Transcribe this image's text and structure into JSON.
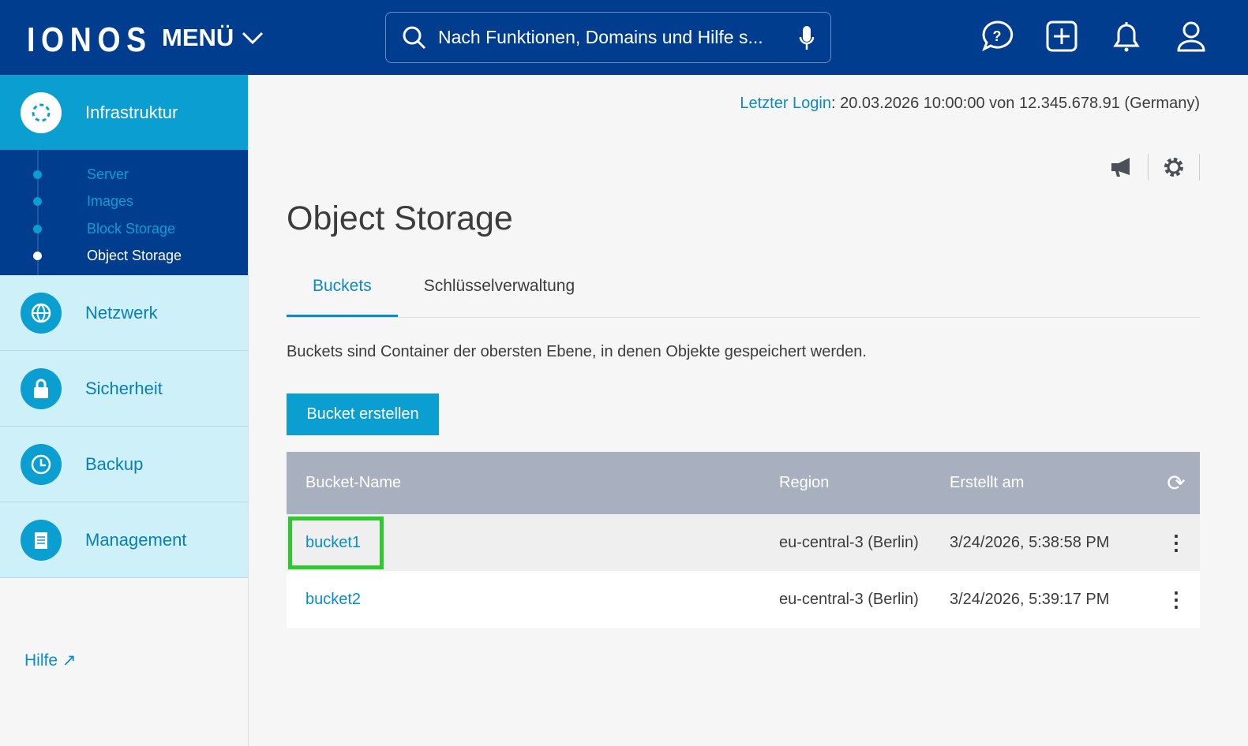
{
  "header": {
    "logo": "IONOS",
    "menu": "MENÜ",
    "search_placeholder": "Nach Funktionen, Domains und Hilfe s..."
  },
  "sidebar": {
    "sections": [
      {
        "label": "Infrastruktur",
        "children": [
          {
            "label": "Server"
          },
          {
            "label": "Images"
          },
          {
            "label": "Block Storage"
          },
          {
            "label": "Object Storage"
          }
        ]
      },
      {
        "label": "Netzwerk"
      },
      {
        "label": "Sicherheit"
      },
      {
        "label": "Backup"
      },
      {
        "label": "Management"
      }
    ],
    "help": "Hilfe"
  },
  "main": {
    "login_label": "Letzter Login",
    "login_text": ": 20.03.2026 10:00:00 von 12.345.678.91 (Germany)",
    "title": "Object Storage",
    "tabs": [
      {
        "label": "Buckets"
      },
      {
        "label": "Schlüsselverwaltung"
      }
    ],
    "description": "Buckets sind Container der obersten Ebene, in denen Objekte gespeichert werden.",
    "create_button": "Bucket erstellen",
    "table": {
      "headers": [
        "Bucket-Name",
        "Region",
        "Erstellt am"
      ],
      "rows": [
        [
          "bucket1",
          "eu-central-3 (Berlin)",
          "3/24/2026, 5:38:58 PM"
        ],
        [
          "bucket2",
          "eu-central-3 (Berlin)",
          "3/24/2026, 5:39:17 PM"
        ]
      ]
    }
  },
  "colors": {
    "header": "#003d8f",
    "accent": "#0b9ed0",
    "highlight": "#2ec92e"
  }
}
